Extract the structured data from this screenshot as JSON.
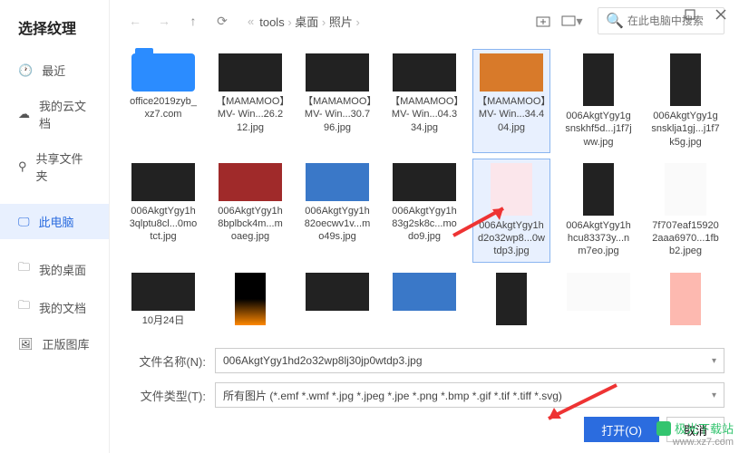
{
  "window": {
    "title": "选择纹理"
  },
  "sidebar": {
    "items": [
      {
        "icon": "clock-icon",
        "label": "最近"
      },
      {
        "icon": "cloud-icon",
        "label": "我的云文档"
      },
      {
        "icon": "share-icon",
        "label": "共享文件夹"
      },
      {
        "icon": "monitor-icon",
        "label": "此电脑"
      },
      {
        "icon": "folder-icon",
        "label": "我的桌面"
      },
      {
        "icon": "folder-icon",
        "label": "我的文档"
      },
      {
        "icon": "image-icon",
        "label": "正版图库"
      }
    ],
    "active_index": 3
  },
  "nav": {
    "breadcrumb_guillemet": "«",
    "crumbs": [
      "tools",
      "桌面",
      "照片"
    ]
  },
  "search": {
    "placeholder": "在此电脑中搜索"
  },
  "grid": {
    "rows": [
      [
        {
          "label": "office2019zyb_xz7.com",
          "kind": "folder"
        },
        {
          "label": "【MAMAMOO】MV- Win...26.212.jpg",
          "kind": "img",
          "cls": "t-dark"
        },
        {
          "label": "【MAMAMOO】MV- Win...30.796.jpg",
          "kind": "img",
          "cls": "t-dark"
        },
        {
          "label": "【MAMAMOO】MV- Win...04.334.jpg",
          "kind": "img",
          "cls": "t-dark"
        },
        {
          "label": "【MAMAMOO】MV- Win...34.404.jpg",
          "kind": "img",
          "cls": "t-orange",
          "selected": true
        },
        {
          "label": "006AkgtYgy1gsnskhf5d...j1f7jww.jpg",
          "kind": "tall",
          "cls": "t-dark"
        },
        {
          "label": "006AkgtYgy1gsnsklja1gj...j1f7k5g.jpg",
          "kind": "tall",
          "cls": "t-dark"
        }
      ],
      [
        {
          "label": "006AkgtYgy1h3qlptu8cl...0motct.jpg",
          "kind": "img",
          "cls": "t-dark"
        },
        {
          "label": "006AkgtYgy1h8bplbck4m...moaeg.jpg",
          "kind": "img",
          "cls": "t-red"
        },
        {
          "label": "006AkgtYgy1h82oecwv1v...mo49s.jpg",
          "kind": "img",
          "cls": "t-blue"
        },
        {
          "label": "006AkgtYgy1h83g2sk8c...modo9.jpg",
          "kind": "img",
          "cls": "t-dark"
        },
        {
          "label": "006AkgtYgy1hd2o32wp8...0wtdp3.jpg",
          "kind": "tall2",
          "cls": "t-pink",
          "selected": true
        },
        {
          "label": "006AkgtYgy1hhcu83373y...nm7eo.jpg",
          "kind": "tall",
          "cls": "t-dark"
        },
        {
          "label": "7f707eaf159202aaa6970...1fbb2.jpeg",
          "kind": "tall2",
          "cls": "t-white"
        }
      ],
      [
        {
          "label": "10⽉24⽇",
          "kind": "img",
          "cls": "t-dark"
        },
        {
          "label": "",
          "kind": "tall",
          "cls": "t-fire"
        },
        {
          "label": "",
          "kind": "img",
          "cls": "t-dark"
        },
        {
          "label": "",
          "kind": "img",
          "cls": "t-blue"
        },
        {
          "label": "",
          "kind": "tall",
          "cls": "t-dark"
        },
        {
          "label": "",
          "kind": "img",
          "cls": "t-white"
        },
        {
          "label": "",
          "kind": "tall",
          "cls": "t-peach"
        }
      ]
    ]
  },
  "footer": {
    "filename_label": "文件名称(N):",
    "filetype_label": "文件类型(T):",
    "filename_value": "006AkgtYgy1hd2o32wp8lj30jp0wtdp3.jpg",
    "filetype_value": "所有图片 (*.emf *.wmf *.jpg *.jpeg *.jpe *.png *.bmp *.gif *.tif *.tiff *.svg)",
    "open_label": "打开(O)",
    "cancel_label": "取消"
  },
  "watermark": {
    "brand": "极光下载站",
    "url": "www.xz7.com"
  }
}
